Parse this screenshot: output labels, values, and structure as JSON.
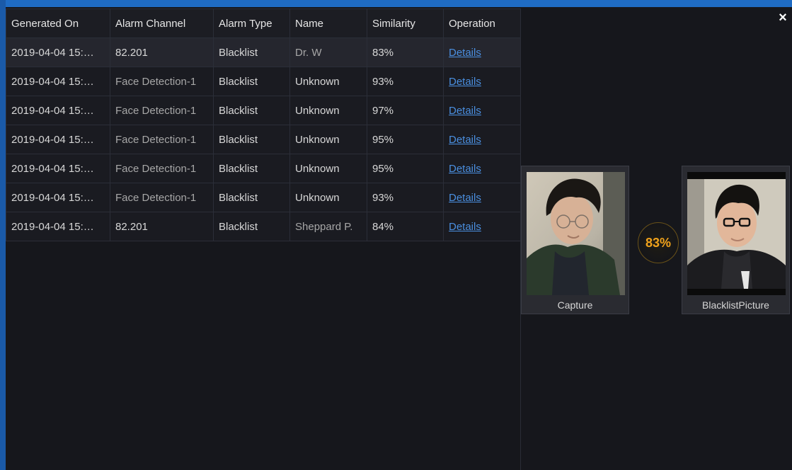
{
  "window": {
    "close_glyph": "×"
  },
  "table": {
    "headers": [
      "Generated On",
      "Alarm Channel",
      "Alarm Type",
      "Name",
      "Similarity",
      "Operation"
    ],
    "rows": [
      {
        "generated_on": "2019-04-04 15:…",
        "alarm_channel": "82.201",
        "alarm_type": "Blacklist",
        "name": "Dr. W",
        "similarity": "83%",
        "operation": "Details"
      },
      {
        "generated_on": "2019-04-04 15:…",
        "alarm_channel": "Face Detection-1",
        "alarm_type": "Blacklist",
        "name": "Unknown",
        "similarity": "93%",
        "operation": "Details"
      },
      {
        "generated_on": "2019-04-04 15:…",
        "alarm_channel": "Face Detection-1",
        "alarm_type": "Blacklist",
        "name": "Unknown",
        "similarity": "97%",
        "operation": "Details"
      },
      {
        "generated_on": "2019-04-04 15:…",
        "alarm_channel": "Face Detection-1",
        "alarm_type": "Blacklist",
        "name": "Unknown",
        "similarity": "95%",
        "operation": "Details"
      },
      {
        "generated_on": "2019-04-04 15:…",
        "alarm_channel": "Face Detection-1",
        "alarm_type": "Blacklist",
        "name": "Unknown",
        "similarity": "95%",
        "operation": "Details"
      },
      {
        "generated_on": "2019-04-04 15:…",
        "alarm_channel": "Face Detection-1",
        "alarm_type": "Blacklist",
        "name": "Unknown",
        "similarity": "93%",
        "operation": "Details"
      },
      {
        "generated_on": "2019-04-04 15:…",
        "alarm_channel": "82.201",
        "alarm_type": "Blacklist",
        "name": "Sheppard P.",
        "similarity": "84%",
        "operation": "Details"
      }
    ]
  },
  "comparison": {
    "capture_label": "Capture",
    "blacklist_label": "BlacklistPicture",
    "similarity": "83%"
  },
  "colors": {
    "background": "#16171c",
    "accent_blue": "#1f6cc4",
    "link": "#4a8fe0",
    "similarity_orange": "#f0a21c"
  }
}
